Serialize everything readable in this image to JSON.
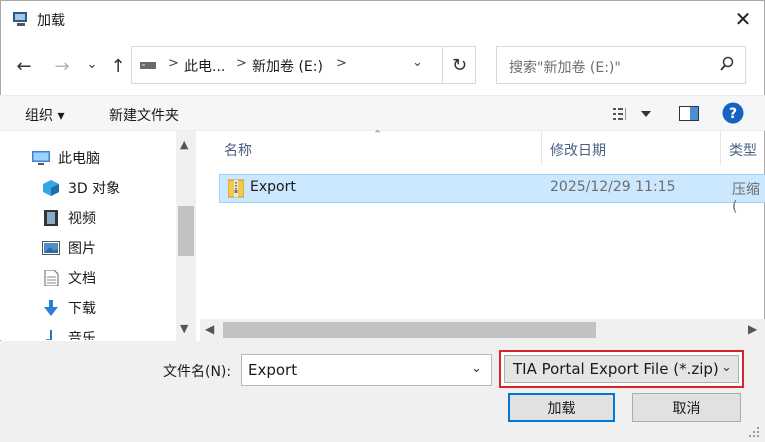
{
  "window": {
    "title": "加载"
  },
  "nav": {
    "back": "←",
    "forward": "→",
    "recent": "⌄",
    "up": "↑",
    "breadcrumb": [
      "此电...",
      "新加卷 (E:)"
    ],
    "breadcrumb_sep": ">",
    "dropdown": "⌄",
    "refresh": "↻"
  },
  "search": {
    "placeholder": "搜索\"新加卷 (E:)\""
  },
  "toolbar": {
    "organize": "组织 ▾",
    "new_folder": "新建文件夹"
  },
  "sidebar": {
    "items": [
      {
        "label": "此电脑",
        "icon": "computer-icon"
      },
      {
        "label": "3D 对象",
        "icon": "cube-icon"
      },
      {
        "label": "视频",
        "icon": "video-icon"
      },
      {
        "label": "图片",
        "icon": "picture-icon"
      },
      {
        "label": "文档",
        "icon": "document-icon"
      },
      {
        "label": "下载",
        "icon": "download-icon"
      },
      {
        "label": "音乐",
        "icon": "music-icon"
      }
    ]
  },
  "columns": {
    "name": "名称",
    "modified": "修改日期",
    "type": "类型"
  },
  "files": [
    {
      "name": "Export",
      "modified": "2025/12/29 11:15",
      "type": "压缩("
    }
  ],
  "bottom": {
    "filename_label": "文件名(N):",
    "filename_value": "Export",
    "filter_value": "TIA Portal Export File (*.zip)",
    "open_button": "加载",
    "cancel_button": "取消"
  },
  "colors": {
    "accent": "#0078d7",
    "selection": "#cce8ff",
    "highlight_border": "#d6262b"
  }
}
